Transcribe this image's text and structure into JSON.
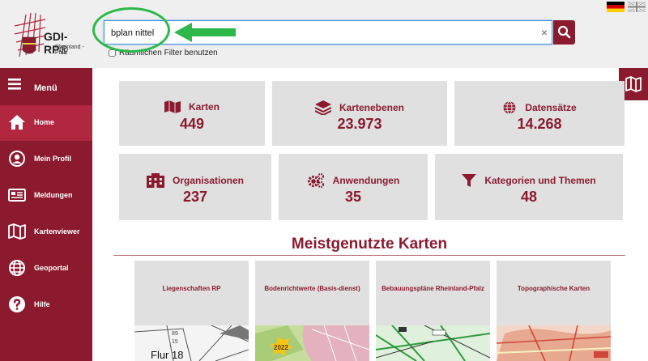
{
  "header": {
    "logo_text": "GDI-RP®",
    "logo_sub": "Rheinland - Pfalz",
    "search_value": "bplan nittel",
    "clear_symbol": "×",
    "filter_label": "Räumlichen Filter benutzen",
    "flags": [
      "flag-germany-icon",
      "flag-uk-icon"
    ]
  },
  "sidebar": {
    "menu_label": "Menü",
    "items": [
      {
        "label": "Home",
        "icon": "home-icon"
      },
      {
        "label": "Mein Profil",
        "icon": "user-circle-icon"
      },
      {
        "label": "Meldungen",
        "icon": "newspaper-icon"
      },
      {
        "label": "Kartenviewer",
        "icon": "map-icon"
      },
      {
        "label": "Geoportal",
        "icon": "globe-icon"
      },
      {
        "label": "Hilfe",
        "icon": "question-icon"
      }
    ]
  },
  "stats": [
    {
      "label": "Karten",
      "value": "449",
      "icon": "map-icon"
    },
    {
      "label": "Kartenebenen",
      "value": "23.973",
      "icon": "layers-icon"
    },
    {
      "label": "Datensätze",
      "value": "14.268",
      "icon": "globe-icon"
    },
    {
      "label": "Organisationen",
      "value": "237",
      "icon": "building-icon"
    },
    {
      "label": "Anwendungen",
      "value": "35",
      "icon": "gears-icon"
    },
    {
      "label": "Kategorien und Themen",
      "value": "48",
      "icon": "filter-icon"
    }
  ],
  "section_title": "Meistgenutzte Karten",
  "tiles": [
    {
      "title": "Liegenschaften RP",
      "thumb_text": "Flur 18"
    },
    {
      "title": "Bodenrichtwerte (Basis-dienst)",
      "thumb_text": "2022"
    },
    {
      "title": "Bebauungspläne Rheinland-Pfalz",
      "thumb_text": ""
    },
    {
      "title": "Topographische Karten",
      "thumb_text": ""
    }
  ],
  "colors": {
    "brand": "#8b1a2f",
    "active": "#b0273f",
    "card": "#e0e0e0",
    "annotation": "#2db84a"
  }
}
